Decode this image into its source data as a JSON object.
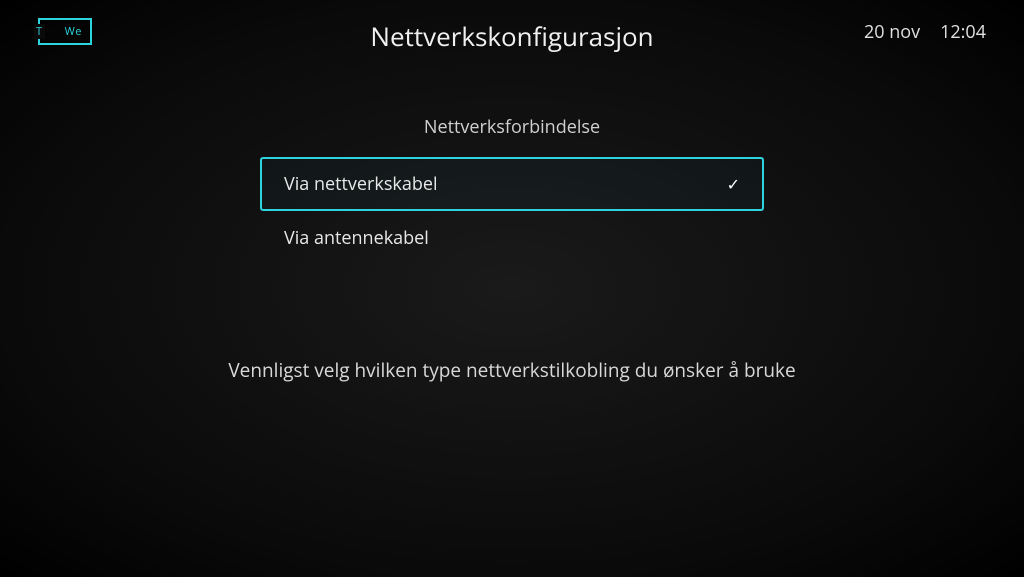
{
  "logo": {
    "prefix": "T",
    "text": "We"
  },
  "title": "Nettverkskonfigurasjon",
  "date": "20 nov",
  "time": "12:04",
  "section_label": "Nettverksforbindelse",
  "options": [
    {
      "label": "Via nettverkskabel",
      "selected": true
    },
    {
      "label": "Via antennekabel",
      "selected": false
    }
  ],
  "instruction": "Vennligst velg hvilken type nettverkstilkobling du ønsker å bruke"
}
